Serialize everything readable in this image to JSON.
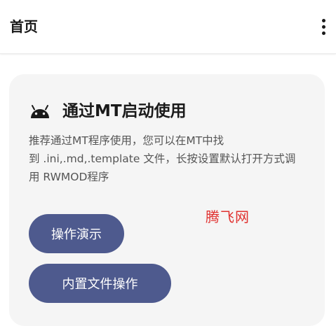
{
  "app_bar": {
    "title": "首页",
    "overflow_icon": "more-vert-icon"
  },
  "card": {
    "icon": "android-icon",
    "icon_color": "#1a1a1a",
    "title": "通过MT启动使用",
    "description_lines": [
      "推荐通过MT程序使用，您可以在MT中找",
      "到 .ini,.md,.template 文件，长按设置默认打开方式调",
      "用 RWMOD程序"
    ],
    "buttons": {
      "demo_label": "操作演示",
      "builtin_label": "内置文件操作"
    }
  },
  "watermark": {
    "text": "腾飞网",
    "color": "#e0312f"
  },
  "colors": {
    "button_bg": "#4e5a8e",
    "card_bg": "#f5f5f5"
  }
}
